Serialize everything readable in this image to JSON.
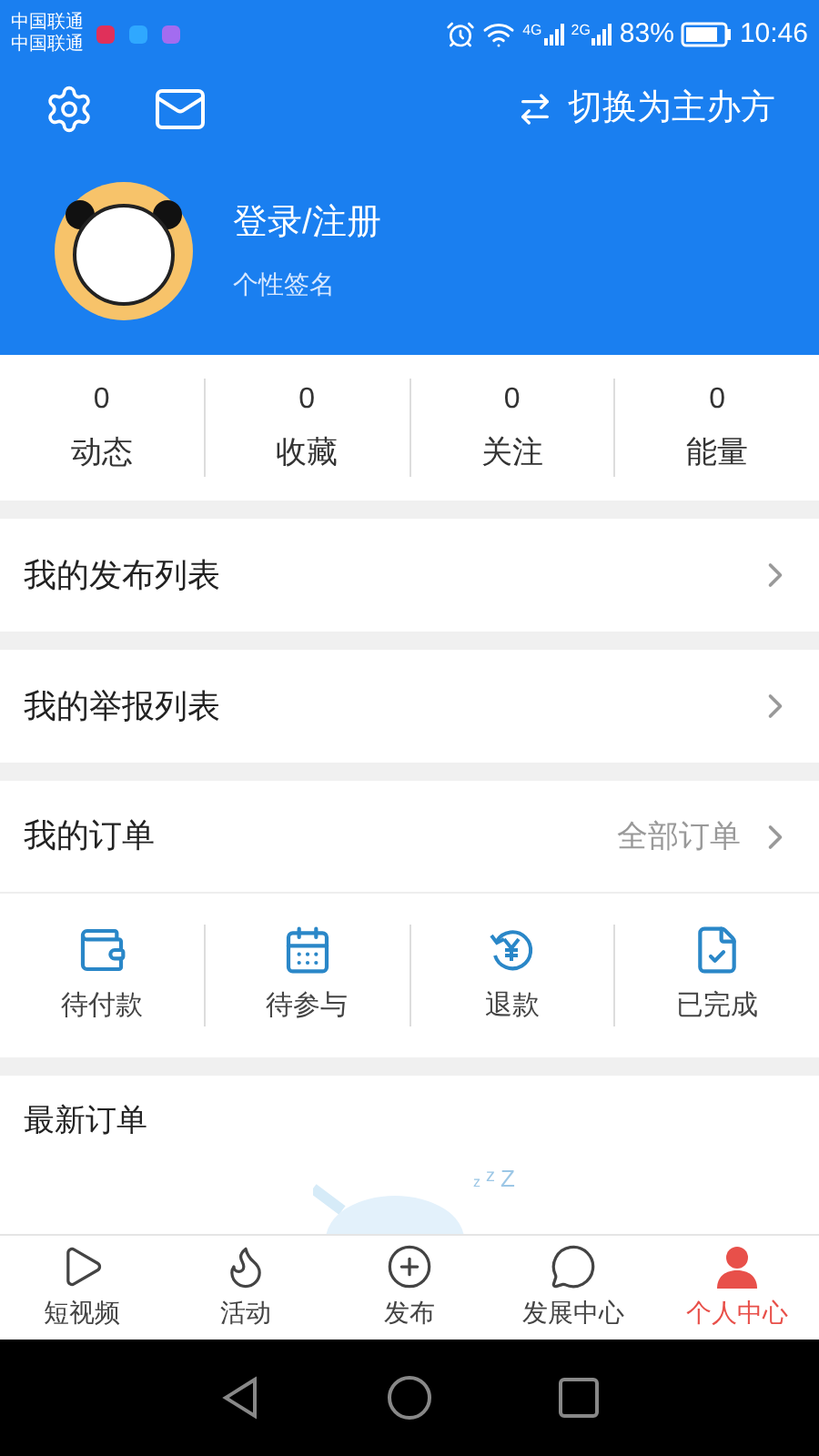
{
  "status_bar": {
    "carriers": [
      "中国联通",
      "中国联通"
    ],
    "network_labels": [
      "4G",
      "2G"
    ],
    "battery": "83%",
    "time": "10:46"
  },
  "header": {
    "switch_label": "切换为主办方"
  },
  "profile": {
    "name": "登录/注册",
    "signature": "个性签名"
  },
  "stats": [
    {
      "value": "0",
      "label": "动态"
    },
    {
      "value": "0",
      "label": "收藏"
    },
    {
      "value": "0",
      "label": "关注"
    },
    {
      "value": "0",
      "label": "能量"
    }
  ],
  "menu": [
    "我的发布列表",
    "我的举报列表"
  ],
  "orders": {
    "title": "我的订单",
    "link": "全部订单",
    "statuses": [
      {
        "kind": "wallet",
        "label": "待付款"
      },
      {
        "kind": "calendar",
        "label": "待参与"
      },
      {
        "kind": "refund",
        "label": "退款"
      },
      {
        "kind": "done",
        "label": "已完成"
      }
    ]
  },
  "latest_orders": {
    "title": "最新订单",
    "sleep_marks": [
      "z",
      "z",
      "Z"
    ]
  },
  "tabs": [
    {
      "kind": "play",
      "label": "短视频",
      "selected": false
    },
    {
      "kind": "flame",
      "label": "活动",
      "selected": false
    },
    {
      "kind": "plus",
      "label": "发布",
      "selected": false
    },
    {
      "kind": "chat",
      "label": "发展中心",
      "selected": false
    },
    {
      "kind": "user",
      "label": "个人中心",
      "selected": true
    }
  ]
}
